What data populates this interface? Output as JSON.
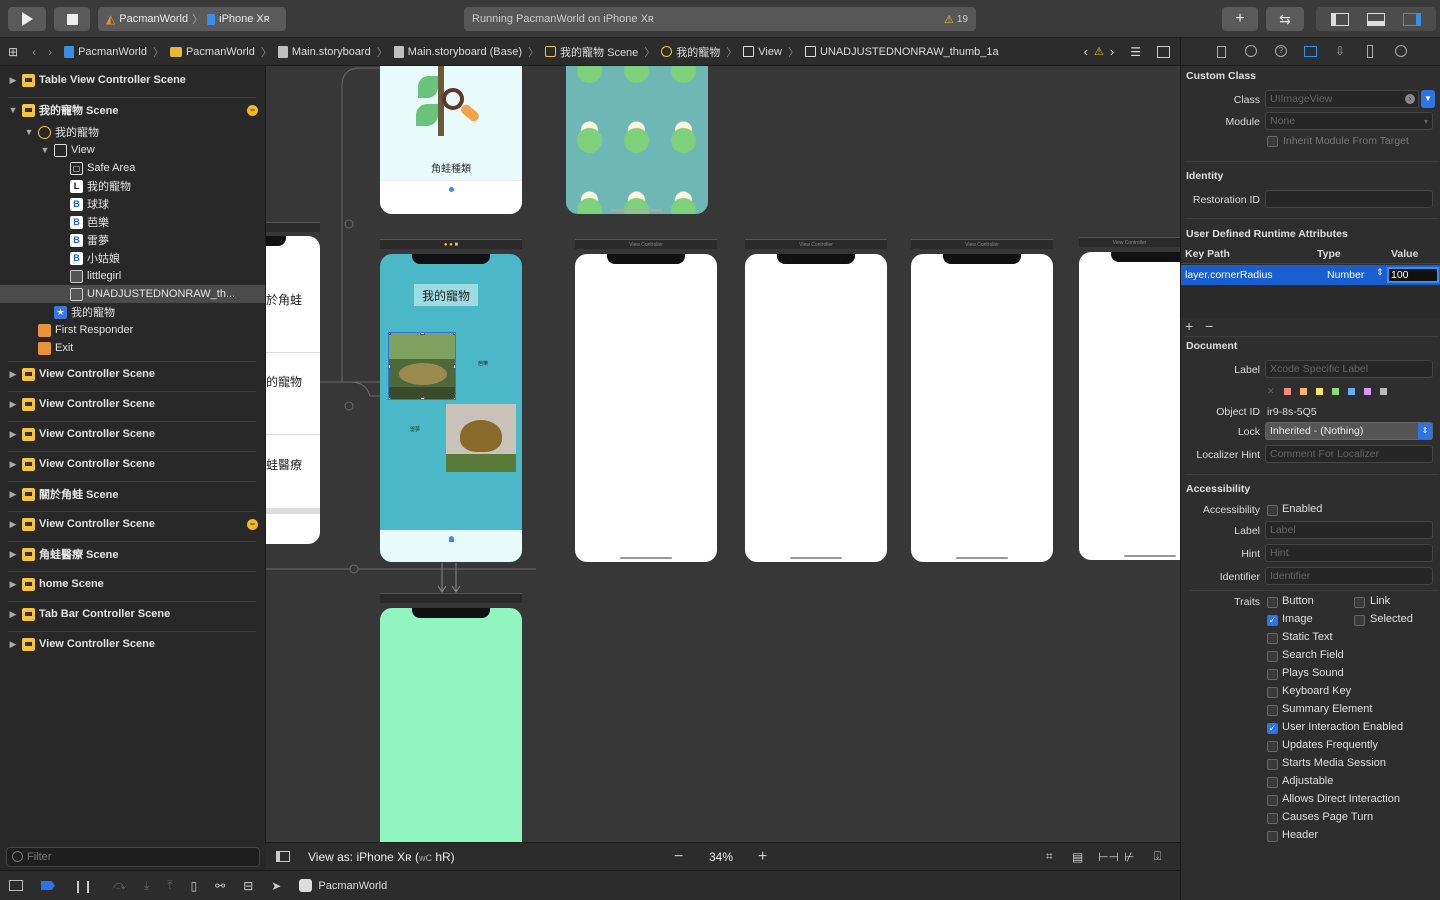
{
  "toolbar": {
    "scheme_project": "PacmanWorld",
    "scheme_device": "iPhone Xʀ",
    "activity_text": "Running PacmanWorld on iPhone Xʀ",
    "warning_count": "19"
  },
  "jumpbar": {
    "items": [
      "PacmanWorld",
      "PacmanWorld",
      "Main.storyboard",
      "Main.storyboard (Base)",
      "我的寵物 Scene",
      "我的寵物",
      "View",
      "UNADJUSTEDNONRAW_thumb_1a"
    ]
  },
  "outline": {
    "rows": [
      {
        "label": "Table View Controller Scene"
      },
      {
        "label": "我的寵物 Scene"
      },
      {
        "label": "我的寵物"
      },
      {
        "label": "View"
      },
      {
        "label": "Safe Area"
      },
      {
        "label": "我的寵物"
      },
      {
        "label": "球球"
      },
      {
        "label": "芭樂"
      },
      {
        "label": "雷夢"
      },
      {
        "label": "小姑娘"
      },
      {
        "label": "littlegirl"
      },
      {
        "label": "UNADJUSTEDNONRAW_th..."
      },
      {
        "label": "我的寵物"
      },
      {
        "label": "First Responder"
      },
      {
        "label": "Exit"
      },
      {
        "label": "View Controller Scene"
      },
      {
        "label": "View Controller Scene"
      },
      {
        "label": "View Controller Scene"
      },
      {
        "label": "View Controller Scene"
      },
      {
        "label": "關於角蛙 Scene"
      },
      {
        "label": "View Controller Scene"
      },
      {
        "label": "角蛙醫療 Scene"
      },
      {
        "label": "home Scene"
      },
      {
        "label": "Tab Bar Controller Scene"
      },
      {
        "label": "View Controller Scene"
      }
    ],
    "filter_placeholder": "Filter"
  },
  "canvas": {
    "frog_search_label": "角蛙種類",
    "pet_title": "我的寵物",
    "pet_small_1": "芭樂",
    "pet_small_2": "雷夢",
    "table_cells": [
      "於角蛙",
      "的寵物",
      "蛙醫療"
    ],
    "scene_bar_label": "View Controller",
    "view_as": "View as: iPhone Xʀ (",
    "view_as_mid": "wC",
    "view_as_end": "hR)",
    "zoom": "34%"
  },
  "colors": {
    "teal_phone": "#4bb8c8",
    "green_phone": "#90f5bf",
    "mint_phone": "#e7fbfb",
    "pattern_bg": "#6fb7b4",
    "accent": "#2c74e8"
  },
  "inspector": {
    "custom_class_title": "Custom Class",
    "class_label": "Class",
    "class_value": "UIImageView",
    "module_label": "Module",
    "module_value": "None",
    "inherit_label": "Inherit Module From Target",
    "identity_title": "Identity",
    "restoration_label": "Restoration ID",
    "udra_title": "User Defined Runtime Attributes",
    "col_key": "Key Path",
    "col_type": "Type",
    "col_value": "Value",
    "attr_key": "layer.cornerRadius",
    "attr_type": "Number",
    "attr_value": "100",
    "document_title": "Document",
    "doc_label_label": "Label",
    "doc_label_placeholder": "Xcode Specific Label",
    "object_id_label": "Object ID",
    "object_id_value": "ir9-8s-5Q5",
    "lock_label": "Lock",
    "lock_value": "Inherited - (Nothing)",
    "localizer_label": "Localizer Hint",
    "localizer_placeholder": "Comment For Localizer",
    "accessibility_title": "Accessibility",
    "acc_label": "Accessibility",
    "acc_enabled": "Enabled",
    "acc_label_label": "Label",
    "acc_label_placeholder": "Label",
    "hint_label": "Hint",
    "hint_placeholder": "Hint",
    "identifier_label": "Identifier",
    "identifier_placeholder": "Identifier",
    "traits_label": "Traits",
    "traits": [
      {
        "label": "Button",
        "checked": false
      },
      {
        "label": "Link",
        "checked": false
      },
      {
        "label": "Image",
        "checked": true
      },
      {
        "label": "Selected",
        "checked": false
      },
      {
        "label": "Static Text",
        "checked": false
      },
      {
        "label": "Search Field",
        "checked": false
      },
      {
        "label": "Plays Sound",
        "checked": false
      },
      {
        "label": "Keyboard Key",
        "checked": false
      },
      {
        "label": "Summary Element",
        "checked": false
      },
      {
        "label": "User Interaction Enabled",
        "checked": true
      },
      {
        "label": "Updates Frequently",
        "checked": false
      },
      {
        "label": "Starts Media Session",
        "checked": false
      },
      {
        "label": "Adjustable",
        "checked": false
      },
      {
        "label": "Allows Direct Interaction",
        "checked": false
      },
      {
        "label": "Causes Page Turn",
        "checked": false
      },
      {
        "label": "Header",
        "checked": false
      }
    ]
  },
  "debugbar": {
    "target": "PacmanWorld"
  }
}
